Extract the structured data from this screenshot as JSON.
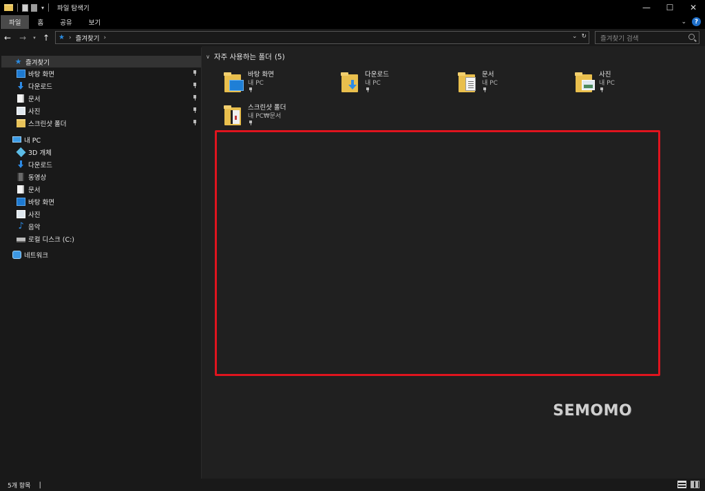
{
  "window": {
    "title": "파일 탐색기",
    "controls": [
      "minimize",
      "maximize",
      "close"
    ]
  },
  "ribbon": {
    "tabs": [
      {
        "label": "파일",
        "active": true
      },
      {
        "label": "홈",
        "active": false
      },
      {
        "label": "공유",
        "active": false
      },
      {
        "label": "보기",
        "active": false
      }
    ],
    "help_label": "?"
  },
  "address": {
    "path": "즐겨찾기",
    "search_placeholder": "즐겨찾기 검색"
  },
  "sidebar": {
    "quick_access": "즐겨찾기",
    "pinned": [
      {
        "label": "바탕 화면",
        "icon": "desktop-icon"
      },
      {
        "label": "다운로드",
        "icon": "download-icon"
      },
      {
        "label": "문서",
        "icon": "document-icon"
      },
      {
        "label": "사진",
        "icon": "picture-icon"
      },
      {
        "label": "스크린샷 폴더",
        "icon": "folder-icon"
      }
    ],
    "this_pc": "내 PC",
    "pc_items": [
      {
        "label": "3D 개체",
        "icon": "3d-objects-icon"
      },
      {
        "label": "다운로드",
        "icon": "download-icon"
      },
      {
        "label": "동영상",
        "icon": "video-icon"
      },
      {
        "label": "문서",
        "icon": "document-icon"
      },
      {
        "label": "바탕 화면",
        "icon": "desktop-icon"
      },
      {
        "label": "사진",
        "icon": "picture-icon"
      },
      {
        "label": "음악",
        "icon": "music-icon"
      },
      {
        "label": "로컬 디스크 (C:)",
        "icon": "disk-icon"
      }
    ],
    "network": "네트워크"
  },
  "main": {
    "section_title": "자주 사용하는 폴더",
    "section_count": "(5)",
    "folders": [
      {
        "name": "바탕 화면",
        "location": "내 PC",
        "icon": "desktop-folder-icon"
      },
      {
        "name": "다운로드",
        "location": "내 PC",
        "icon": "download-folder-icon"
      },
      {
        "name": "문서",
        "location": "내 PC",
        "icon": "document-folder-icon"
      },
      {
        "name": "사진",
        "location": "내 PC",
        "icon": "picture-folder-icon"
      },
      {
        "name": "스크린샷 폴더",
        "location": "내 PC₩문서",
        "icon": "screenshot-folder-icon"
      }
    ]
  },
  "watermark": "SEMOMO",
  "status": {
    "item_count": "5개 항목",
    "separator": "|"
  },
  "colors": {
    "accent": "#2b8be0",
    "highlight_box": "#e0141e",
    "folder": "#e9bf4d"
  }
}
